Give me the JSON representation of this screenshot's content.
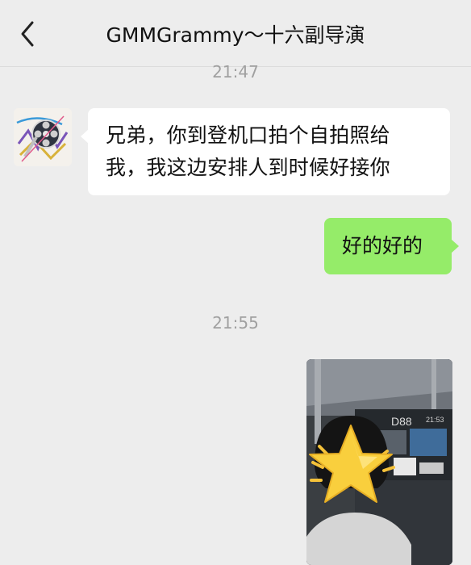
{
  "header": {
    "title": "GMMGrammy～十六副导演",
    "back_icon": "chevron-left-icon"
  },
  "messages": [
    {
      "type": "timestamp",
      "text": "21:47"
    },
    {
      "type": "text",
      "direction": "incoming",
      "lines": [
        "兄弟，你到登机口拍个自拍照给",
        "我，我这边安排人到时候好接你"
      ]
    },
    {
      "type": "text",
      "direction": "outgoing",
      "text": "好的好的"
    },
    {
      "type": "timestamp",
      "text": "21:55"
    },
    {
      "type": "image",
      "direction": "outgoing",
      "gate_sign": "D88",
      "gate_time": "21:53"
    }
  ],
  "colors": {
    "background": "#ededed",
    "incoming_bubble": "#ffffff",
    "outgoing_bubble": "#95ec69",
    "timestamp": "#a0a0a0"
  }
}
